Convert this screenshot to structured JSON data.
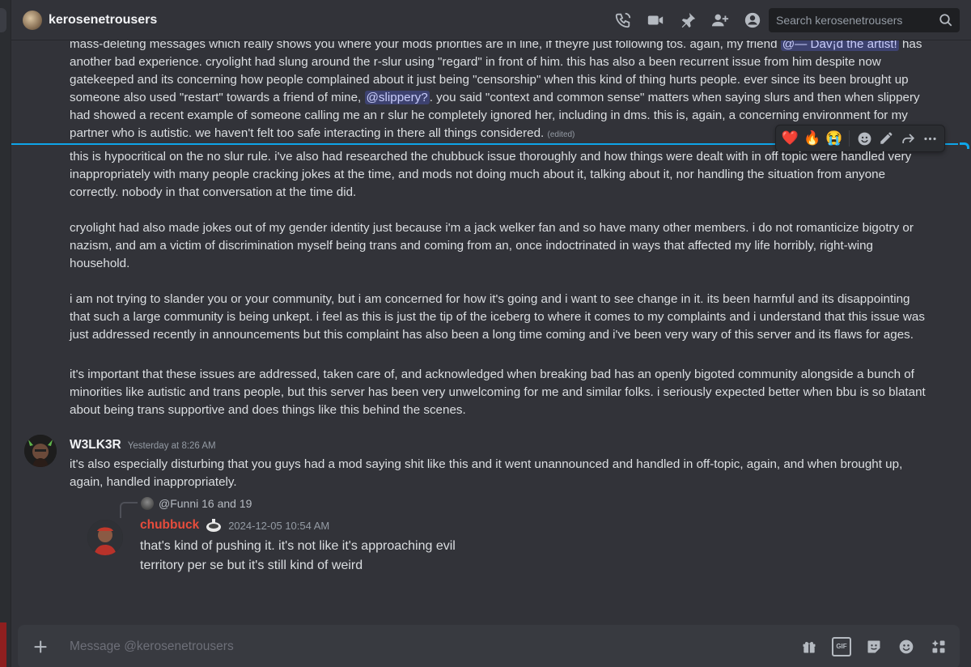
{
  "header": {
    "dm_name": "kerosenetrousers",
    "search_placeholder": "Search kerosenetrousers",
    "tools": [
      "voice-call-icon",
      "video-call-icon",
      "pin-icon",
      "add-friends-icon",
      "user-profile-icon"
    ]
  },
  "messages": {
    "first_block": {
      "p1_before_mention1": "mass-deleting messages which really shows you where your mods priorities are in line, if theyre just following tos. again, my friend ",
      "mention1": "@— Dav¡d the artist!",
      "p1_after_mention1": " has another bad experience. cryolight had slung around the r-slur using \"regard\" in front of him. this has also a been recurrent issue from him despite now gatekeeped and its concerning how people complained about it just being \"censorship\" when this kind of thing hurts people. ever since its been brought up someone also used \"restart\" towards a friend of mine, ",
      "mention2": "@slippery?",
      "p1_after_mention2": ". you said \"context and common sense\" matters when saying slurs and then when slippery had showed a recent example of someone calling me an r slur he completely ignored her, including in dms. this is, again, a concerning environment for my partner who is autistic. we haven't felt too safe interacting in there all things considered. ",
      "edited": "(edited)"
    },
    "reactions": [
      "❤️",
      "🔥",
      "😭"
    ],
    "second_block": {
      "p2": "this is hypocritical on the no slur rule. i've also had researched the chubbuck issue thoroughly and how things were dealt with in off topic were handled very inappropriately with many people cracking jokes at the time, and mods not doing much about it, talking about it, nor handling the situation from anyone correctly. nobody in that conversation at the time did.",
      "p3": "cryolight had also made jokes out of my gender identity just because i'm a jack welker fan and so have many other members. i do not romanticize bigotry or nazism, and am a victim of discrimination myself being trans and coming from an, once indoctrinated in ways that affected my life horribly, right-wing household.",
      "p4": "i am not trying to slander you or your community, but i am concerned for how it's going and i want to see change in it. its been harmful and its disappointing that such a large community is being unkept. i feel as this is just the tip of the iceberg to where it comes to my complaints and i understand that this issue was just addressed recently in announcements but this complaint has also been a long time coming and i've been very wary of this server and its flaws for ages.",
      "p5": "it's important that these issues are addressed, taken care of, and acknowledged when breaking bad has an openly bigoted community alongside a bunch of minorities like autistic and trans people, but this server has been very unwelcoming for me and similar folks. i seriously expected better when bbu is so blatant about being trans supportive and does things like this behind the scenes."
    },
    "w3lk3r": {
      "author": "W3LK3R",
      "timestamp": "Yesterday at 8:26 AM",
      "text": "it's also especially disturbing that you guys had a mod saying shit like this and it went unannounced and handled in off-topic, again, and when brought up, again, handled inappropriately."
    },
    "embedded": {
      "reply_name": "@Funni",
      "reply_text": "16 and 19",
      "author": "chubbuck",
      "timestamp": "2024-12-05 10:54 AM",
      "line1": "that's kind of pushing it. it's not like it's approaching evil",
      "line2": "territory per se but it's still kind of weird"
    }
  },
  "composer": {
    "placeholder": "Message @kerosenetrousers",
    "tools": [
      "gift-icon",
      "gif-icon",
      "sticker-icon",
      "emoji-icon",
      "apps-icon"
    ],
    "gif_label": "GIF"
  },
  "colors": {
    "background": "#323339",
    "accent_new_divider": "#0ea5e9",
    "mention_bg": "#3d4270",
    "chubbuck_name": "#e74c3c"
  }
}
